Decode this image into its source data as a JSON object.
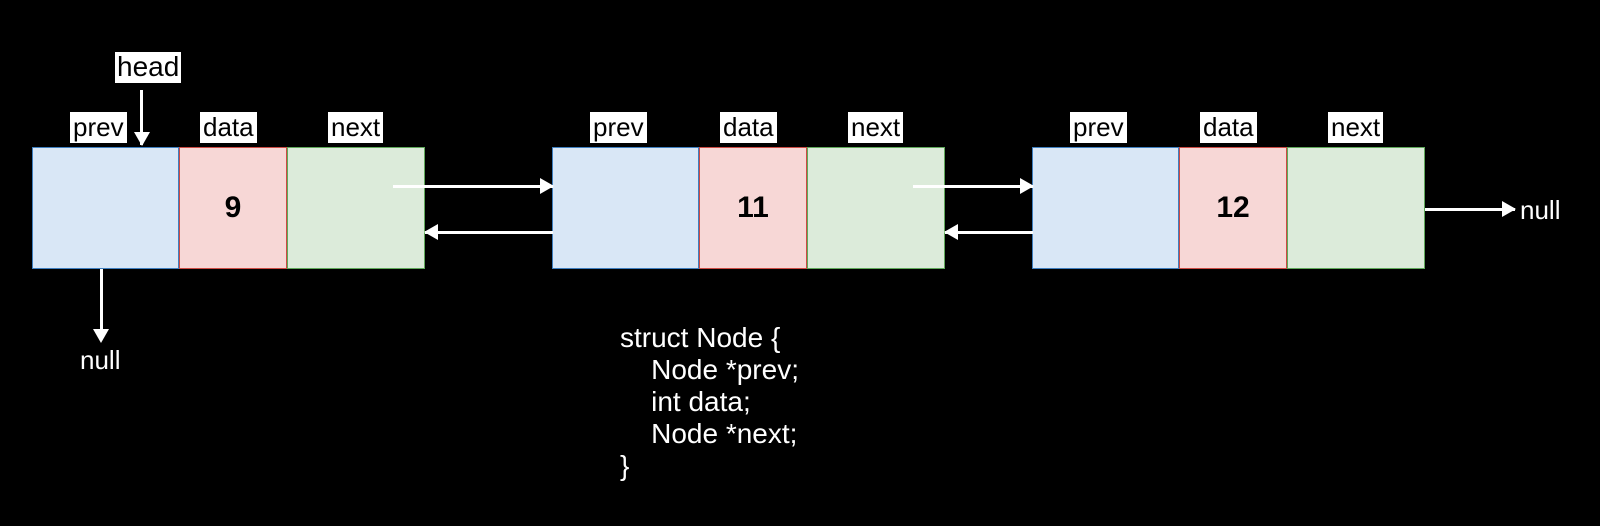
{
  "labels": {
    "head": "head",
    "prev": "prev",
    "data": "data",
    "next": "next",
    "null": "null"
  },
  "nodes": [
    {
      "value": "9"
    },
    {
      "value": "11"
    },
    {
      "value": "12"
    }
  ],
  "caption": "struct Node {\n    Node *prev;\n    int data;\n    Node *next;\n}"
}
